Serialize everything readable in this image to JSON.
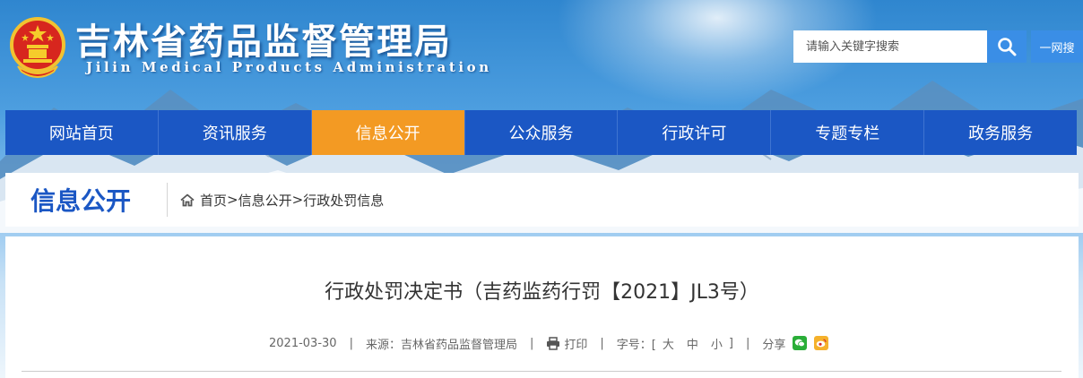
{
  "header": {
    "title": "吉林省药品监督管理局",
    "subtitle": "Jilin Medical Products Administration",
    "search": {
      "placeholder": "请输入关键字搜索",
      "whole_web_label": "一网搜"
    }
  },
  "nav": {
    "items": [
      {
        "label": "网站首页"
      },
      {
        "label": "资讯服务"
      },
      {
        "label": "信息公开",
        "active": true
      },
      {
        "label": "公众服务"
      },
      {
        "label": "行政许可"
      },
      {
        "label": "专题专栏"
      },
      {
        "label": "政务服务"
      }
    ]
  },
  "section": {
    "title": "信息公开",
    "breadcrumb": [
      {
        "label": "首页"
      },
      {
        "label": "信息公开"
      },
      {
        "label": "行政处罚信息"
      }
    ],
    "separator": ">"
  },
  "article": {
    "title": "行政处罚决定书（吉药监药行罚【2021】JL3号）",
    "date": "2021-03-30",
    "source_label": "来源：",
    "source": "吉林省药品监督管理局",
    "print_label": "打印",
    "font_size_label": "字号：[",
    "font_sizes": [
      "大",
      "中",
      "小"
    ],
    "font_size_close": "]",
    "share_label": "分享",
    "meta_separator": "|"
  },
  "colors": {
    "nav_bg": "#1b57c4",
    "nav_active": "#f39a23",
    "section_title": "#1b57c4",
    "search_button": "#3a8ee6",
    "wechat": "#2aae38",
    "weibo": "#f5b12b"
  },
  "icons": {
    "emblem": "national-emblem-icon",
    "search": "search-icon",
    "home": "home-icon",
    "print": "printer-icon",
    "wechat": "wechat-icon",
    "weibo": "weibo-icon"
  }
}
